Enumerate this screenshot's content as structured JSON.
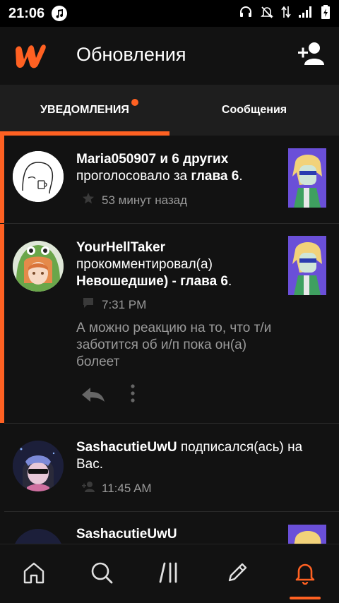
{
  "status_bar": {
    "time": "21:06"
  },
  "app_bar": {
    "title": "Обновления"
  },
  "tabs": [
    {
      "label": "УВЕДОМЛЕНИЯ",
      "active": true,
      "has_dot": true
    },
    {
      "label": "Сообщения",
      "active": false
    }
  ],
  "notifications": [
    {
      "user": "Maria050907 и 6 других",
      "action": "проголосовало за",
      "target": "глава 6",
      "suffix": ".",
      "time": "53 минут назад",
      "meta_icon": "star-icon",
      "unread": true
    },
    {
      "user": "YourHellTaker",
      "action": "прокомментировал(а)",
      "target": "Невошедшие) - глава 6",
      "suffix": ".",
      "time": "7:31 PM",
      "meta_icon": "comment-icon",
      "comment": "А можно реакцию на то, что т/и заботится об и/п пока он(а) болеет",
      "unread": true
    },
    {
      "user": "SashacutieUwU",
      "action": "подписался(ась) на Вас.",
      "time": "11:45 AM",
      "meta_icon": "follower-icon",
      "unread": false
    },
    {
      "user": "SashacutieUwU",
      "unread": false
    }
  ],
  "bottom_nav": [
    {
      "icon": "home-icon",
      "active": false
    },
    {
      "icon": "search-icon",
      "active": false
    },
    {
      "icon": "library-icon",
      "active": false
    },
    {
      "icon": "write-icon",
      "active": false
    },
    {
      "icon": "bell-icon",
      "active": true
    }
  ],
  "colors": {
    "accent": "#ff6122",
    "background": "#121212",
    "tab_bar": "#1e1e1e",
    "muted_text": "#9a9a9a"
  }
}
